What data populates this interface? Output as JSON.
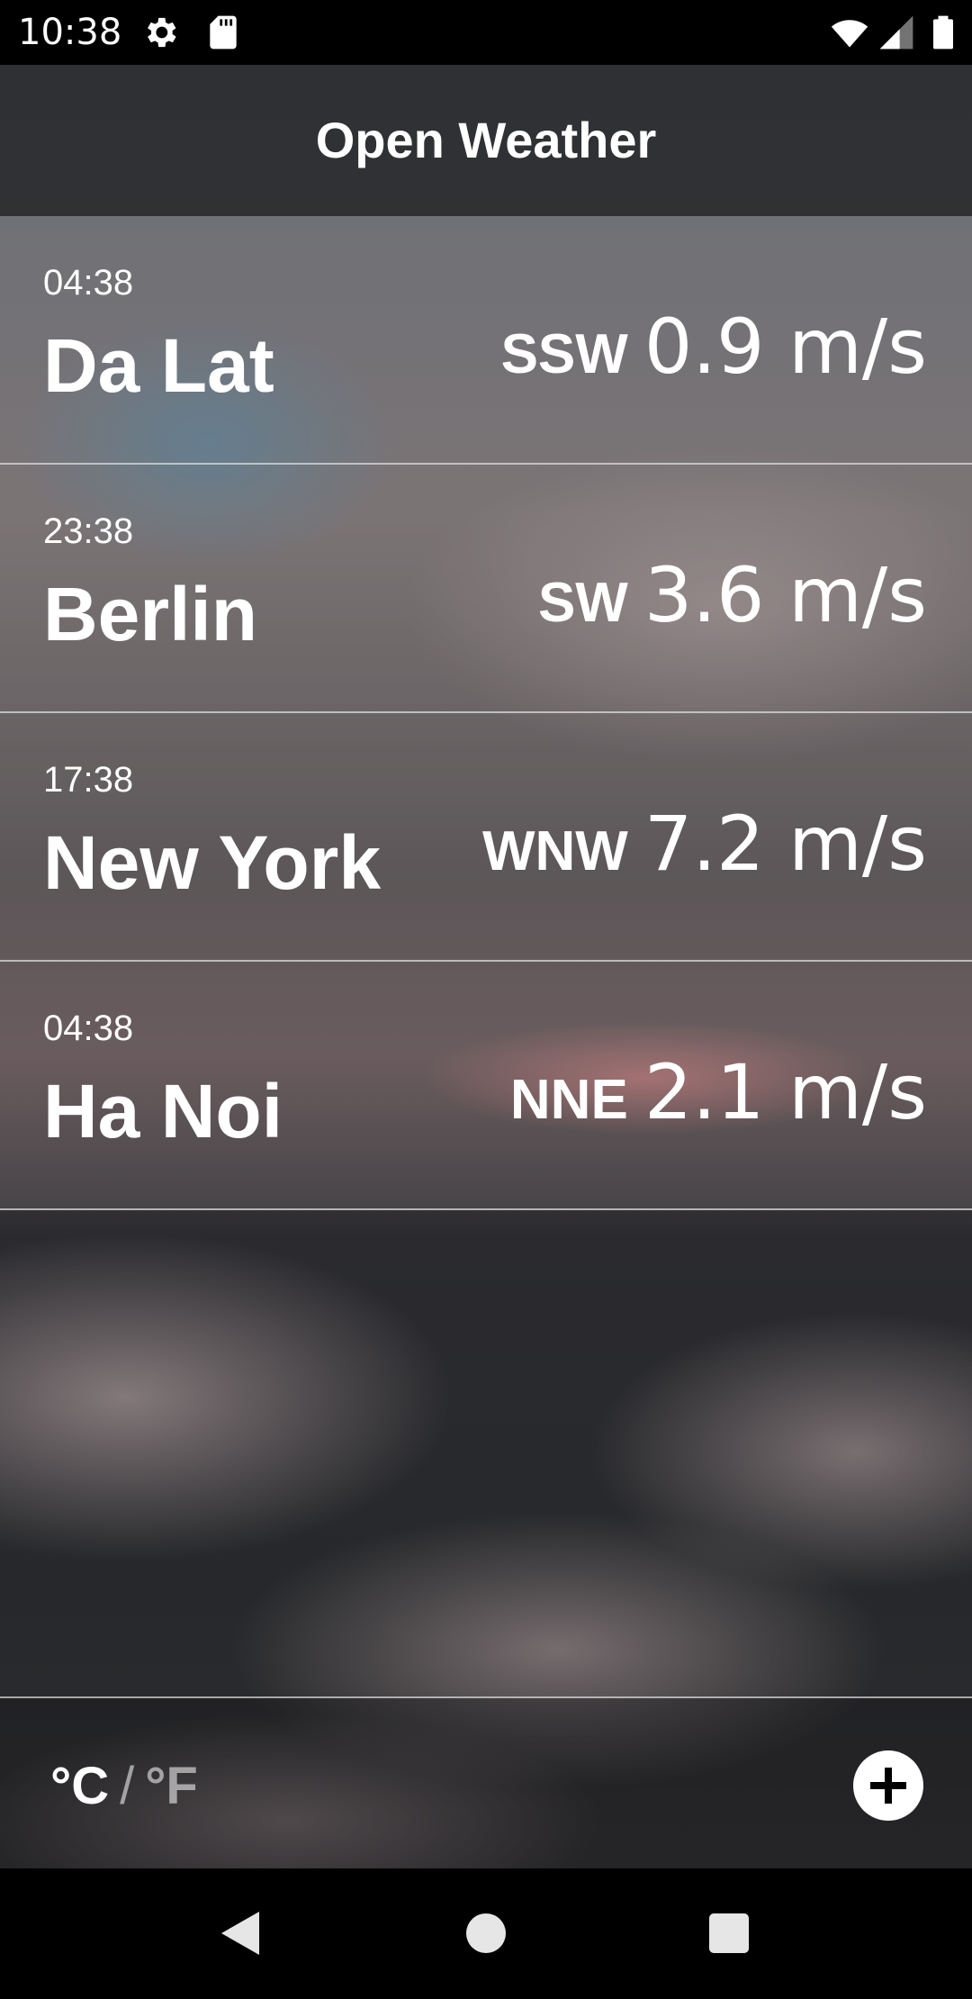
{
  "status_bar": {
    "time": "10:38",
    "icons": [
      "gear-icon",
      "sd-card-icon",
      "wifi-icon",
      "signal-icon",
      "battery-icon"
    ]
  },
  "app_bar": {
    "title": "Open Weather"
  },
  "cities": [
    {
      "time": "04:38",
      "name": "Da Lat",
      "wind_dir": "SSW",
      "wind_speed": "0.9 m/s"
    },
    {
      "time": "23:38",
      "name": "Berlin",
      "wind_dir": "SW",
      "wind_speed": "3.6 m/s"
    },
    {
      "time": "17:38",
      "name": "New York",
      "wind_dir": "WNW",
      "wind_speed": "7.2 m/s"
    },
    {
      "time": "04:38",
      "name": "Ha Noi",
      "wind_dir": "NNE",
      "wind_speed": "2.1 m/s"
    }
  ],
  "footer": {
    "unit_c": "°C",
    "unit_sep": "/",
    "unit_f": "°F",
    "add_icon": "plus-circle-icon"
  },
  "nav_bar": {
    "icons": [
      "back-icon",
      "home-icon",
      "recents-icon"
    ]
  }
}
